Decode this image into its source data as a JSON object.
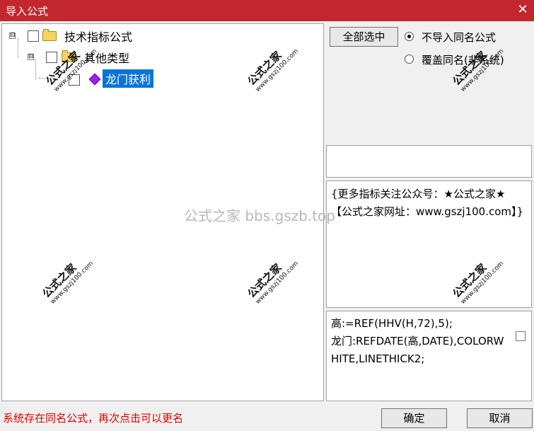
{
  "window": {
    "title": "导入公式",
    "close_glyph": "✕"
  },
  "tree": {
    "root": {
      "expander": "⊟",
      "label": "技术指标公式"
    },
    "child": {
      "expander": "⊟",
      "label": "其他类型"
    },
    "leaf": {
      "label": "龙门获利"
    }
  },
  "controls": {
    "select_all": "全部选中",
    "radio_no_import": "不导入同名公式",
    "radio_overwrite": "覆盖同名(非系统)",
    "ok": "确定",
    "cancel": "取消"
  },
  "info": {
    "description": "{更多指标关注公众号：★公式之家★ 【公式之家网址：www.gszj100.com】}"
  },
  "code": {
    "text": "高:=REF(HHV(H,72),5);\n龙门:REFDATE(高,DATE),COLORWHITE,LINETHICK2;"
  },
  "status": {
    "message": "系统存在同名公式，再次点击可以更名"
  },
  "watermark": {
    "center": "公式之家 bbs.gszb.top",
    "stamp_big": "公式之家",
    "stamp_small": "www.gszj100.com"
  }
}
